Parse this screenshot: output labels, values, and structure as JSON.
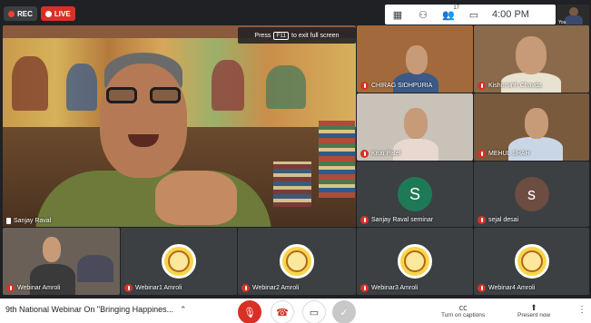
{
  "status": {
    "rec_label": "REC",
    "live_label": "LIVE"
  },
  "topbar": {
    "participants_count": "17",
    "time": "4:00 PM",
    "self_label": "You"
  },
  "fullscreen_hint": {
    "press": "Press",
    "key": "F11",
    "rest": "to exit full screen"
  },
  "main_speaker": {
    "name": "Sanjay Raval"
  },
  "participants": [
    {
      "name": "CHIRAG SIDHPURIA"
    },
    {
      "name": "Kishorsinh Chavda"
    },
    {
      "name": "Kruti Patel"
    },
    {
      "name": "MEHUL SHAH"
    },
    {
      "name": "Sanjay Raval seminar",
      "initial": "S"
    },
    {
      "name": "sejal desai",
      "initial": "s"
    },
    {
      "name": "Webinar Amroli"
    },
    {
      "name": "Webinar1 Amroli"
    },
    {
      "name": "Webinar2 Amroli"
    },
    {
      "name": "Webinar3 Amroli"
    },
    {
      "name": "Webinar4 Amroli"
    }
  ],
  "colors": {
    "avatar_green": "#1e7a56",
    "avatar_brown": "#6d4c41",
    "muted_red": "#d93025"
  },
  "bottombar": {
    "meeting_title": "9th National Webinar On \"Bringing Happines...",
    "captions_label": "Turn on captions",
    "present_label": "Present now"
  },
  "icons": {
    "grid": "grid-icon",
    "participants": "people-icon",
    "chat": "chat-icon",
    "mic": "mic-off-icon",
    "hangup": "hangup-icon",
    "camera": "camera-icon",
    "captions": "captions-icon",
    "present": "present-icon",
    "more": "more-vert-icon"
  }
}
